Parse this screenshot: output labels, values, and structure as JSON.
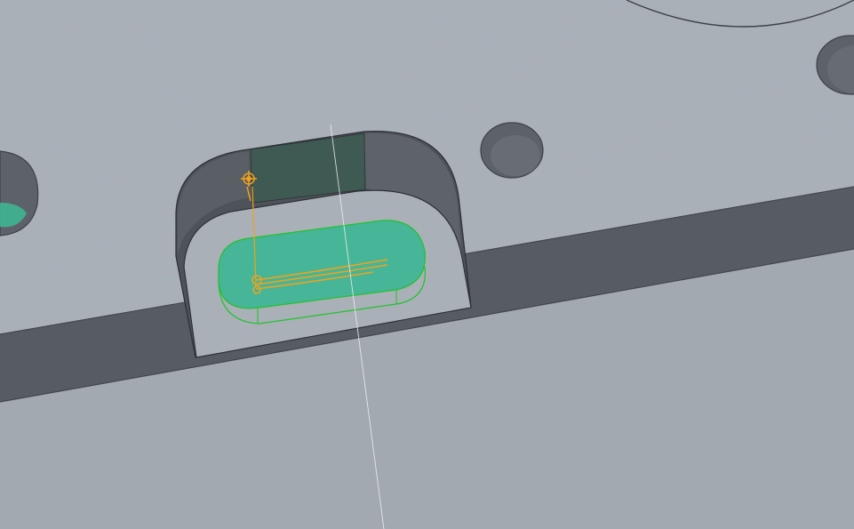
{
  "viewport": {
    "kind": "3d-cad-viewport",
    "background_color": "#a2a9b1",
    "top_face_color": "#a9b0b8",
    "side_wall_color": "#575c63",
    "shadow_color": "#4e535a",
    "highlight_color": "#3fb594",
    "highlight_edge_color": "#22c22a",
    "sketch_color": "#f2a21a",
    "guide_line_color": "#8cc8c6"
  },
  "scene": {
    "features": [
      {
        "name": "slot-pocket",
        "shape": "rounded-rectangle",
        "state": "normal"
      },
      {
        "name": "inner-slot-face",
        "shape": "obround",
        "state": "selected"
      },
      {
        "name": "round-hole-center",
        "shape": "circle",
        "state": "normal"
      },
      {
        "name": "round-hole-right",
        "shape": "circle",
        "state": "normal"
      },
      {
        "name": "round-hole-left",
        "shape": "circle",
        "state": "partially-visible"
      },
      {
        "name": "large-bore-top",
        "shape": "circle",
        "state": "partially-visible"
      }
    ],
    "sketch": {
      "visible": true,
      "icon": "sketch-origin-anchor-icon"
    }
  }
}
